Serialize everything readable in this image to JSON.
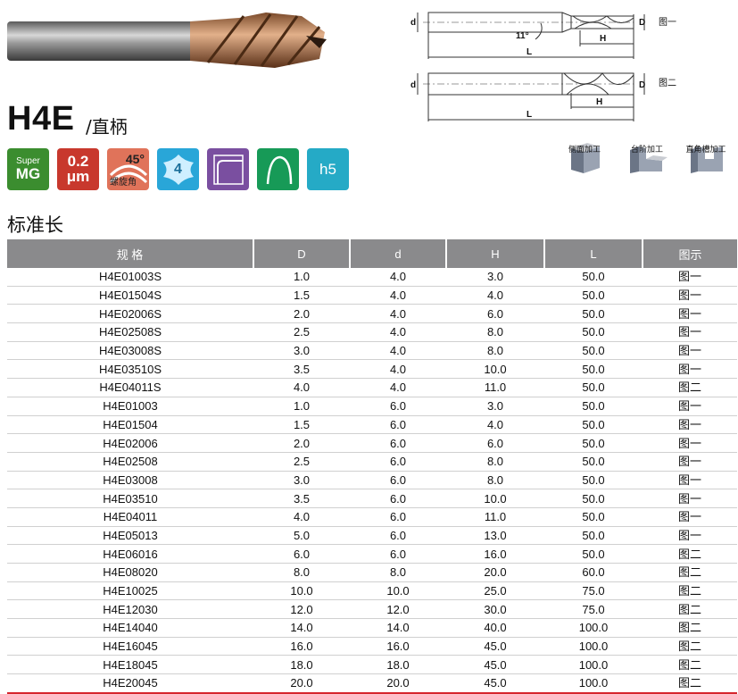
{
  "product": {
    "code": "H4E",
    "shank": "/直柄"
  },
  "icons": [
    {
      "name": "super-mg-icon",
      "top": "Super",
      "bottom": "MG",
      "color": "#3b8d2f"
    },
    {
      "name": "coating-icon",
      "top": "0.2",
      "bottom": "μm",
      "color": "#c8382d"
    },
    {
      "name": "helix-angle-icon",
      "top": "45°",
      "bottom": "螺旋角",
      "color": "#e0735a"
    },
    {
      "name": "four-flute-icon",
      "top": "4",
      "color": "#29a6d8"
    },
    {
      "name": "corner-radius-icon",
      "color": "#7a4fa0"
    },
    {
      "name": "ball-nose-icon",
      "color": "#179a57"
    },
    {
      "name": "h5-tolerance-icon",
      "top": "h5",
      "color": "#25aac6"
    }
  ],
  "diagram": {
    "fig1": "图一",
    "fig2": "图二",
    "angle": "11°",
    "labels": {
      "d": "d",
      "D": "D",
      "H": "H",
      "L": "L"
    }
  },
  "operations": [
    "侧面加工",
    "台阶加工",
    "直角槽加工"
  ],
  "section_title": "标准长",
  "table": {
    "headers": [
      "规 格",
      "D",
      "d",
      "H",
      "L",
      "图示"
    ],
    "rows": [
      [
        "H4E01003S",
        "1.0",
        "4.0",
        "3.0",
        "50.0",
        "图一"
      ],
      [
        "H4E01504S",
        "1.5",
        "4.0",
        "4.0",
        "50.0",
        "图一"
      ],
      [
        "H4E02006S",
        "2.0",
        "4.0",
        "6.0",
        "50.0",
        "图一"
      ],
      [
        "H4E02508S",
        "2.5",
        "4.0",
        "8.0",
        "50.0",
        "图一"
      ],
      [
        "H4E03008S",
        "3.0",
        "4.0",
        "8.0",
        "50.0",
        "图一"
      ],
      [
        "H4E03510S",
        "3.5",
        "4.0",
        "10.0",
        "50.0",
        "图一"
      ],
      [
        "H4E04011S",
        "4.0",
        "4.0",
        "11.0",
        "50.0",
        "图二"
      ],
      [
        "H4E01003",
        "1.0",
        "6.0",
        "3.0",
        "50.0",
        "图一"
      ],
      [
        "H4E01504",
        "1.5",
        "6.0",
        "4.0",
        "50.0",
        "图一"
      ],
      [
        "H4E02006",
        "2.0",
        "6.0",
        "6.0",
        "50.0",
        "图一"
      ],
      [
        "H4E02508",
        "2.5",
        "6.0",
        "8.0",
        "50.0",
        "图一"
      ],
      [
        "H4E03008",
        "3.0",
        "6.0",
        "8.0",
        "50.0",
        "图一"
      ],
      [
        "H4E03510",
        "3.5",
        "6.0",
        "10.0",
        "50.0",
        "图一"
      ],
      [
        "H4E04011",
        "4.0",
        "6.0",
        "11.0",
        "50.0",
        "图一"
      ],
      [
        "H4E05013",
        "5.0",
        "6.0",
        "13.0",
        "50.0",
        "图一"
      ],
      [
        "H4E06016",
        "6.0",
        "6.0",
        "16.0",
        "50.0",
        "图二"
      ],
      [
        "H4E08020",
        "8.0",
        "8.0",
        "20.0",
        "60.0",
        "图二"
      ],
      [
        "H4E10025",
        "10.0",
        "10.0",
        "25.0",
        "75.0",
        "图二"
      ],
      [
        "H4E12030",
        "12.0",
        "12.0",
        "30.0",
        "75.0",
        "图二"
      ],
      [
        "H4E14040",
        "14.0",
        "14.0",
        "40.0",
        "100.0",
        "图二"
      ],
      [
        "H4E16045",
        "16.0",
        "16.0",
        "45.0",
        "100.0",
        "图二"
      ],
      [
        "H4E18045",
        "18.0",
        "18.0",
        "45.0",
        "100.0",
        "图二"
      ],
      [
        "H4E20045",
        "20.0",
        "20.0",
        "45.0",
        "100.0",
        "图二"
      ]
    ]
  }
}
